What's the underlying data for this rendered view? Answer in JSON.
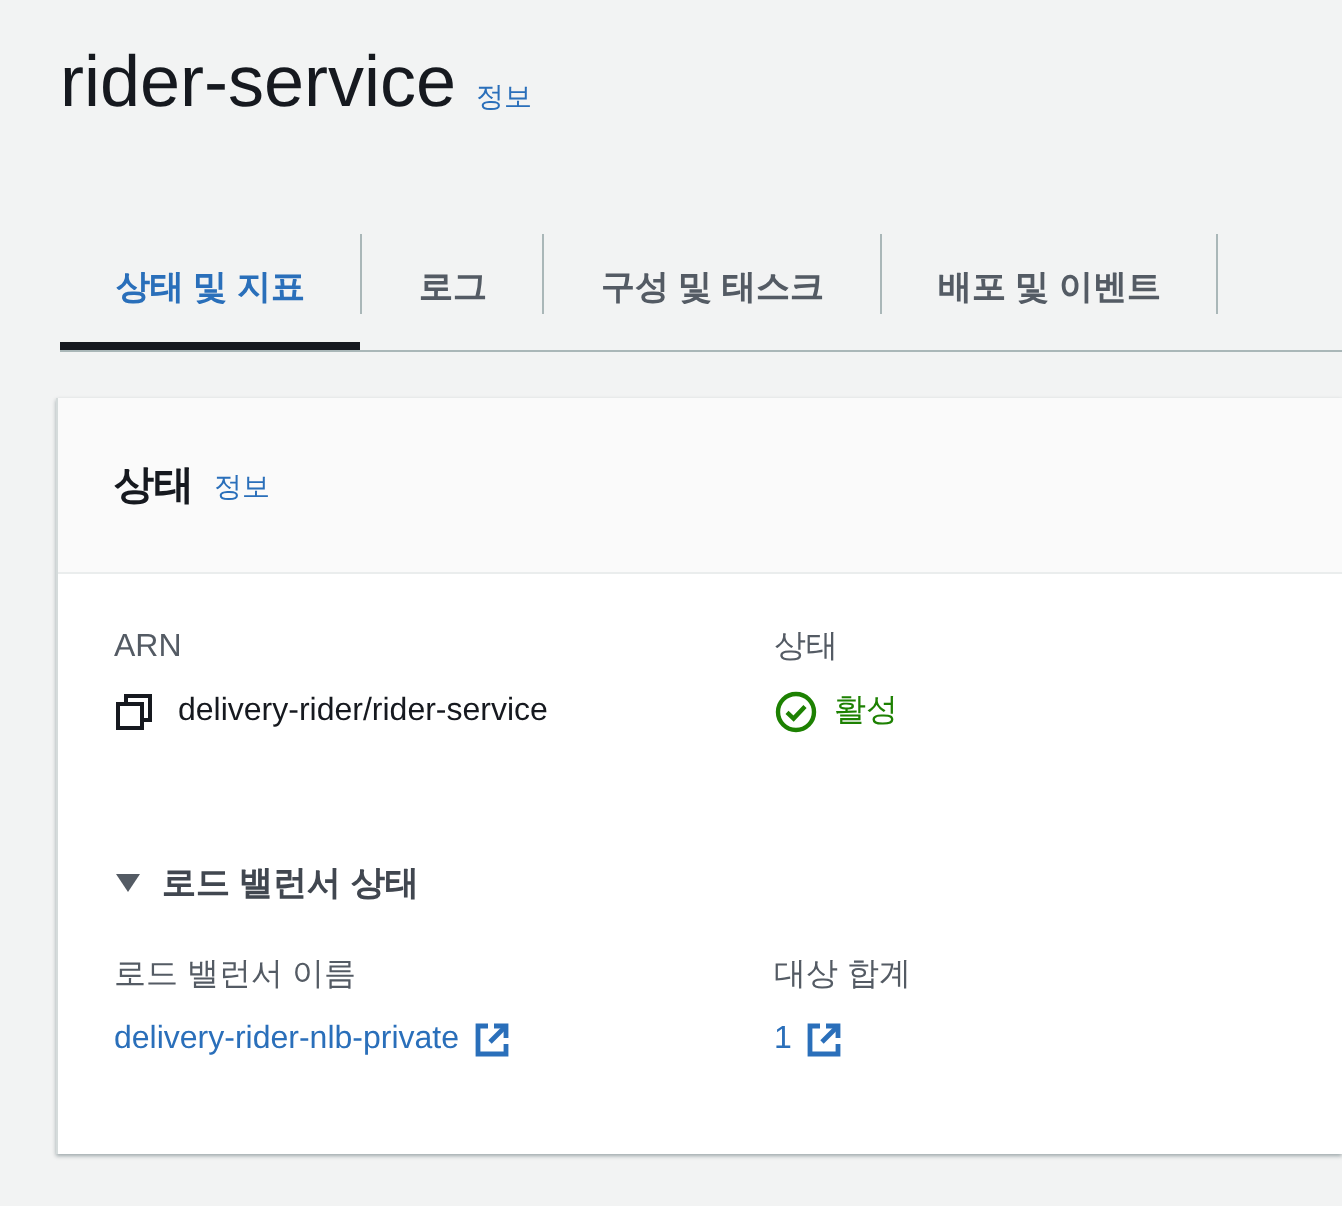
{
  "page": {
    "title": "rider-service",
    "info_link": "정보"
  },
  "tabs": [
    {
      "label": "상태 및 지표",
      "selected": true
    },
    {
      "label": "로그",
      "selected": false
    },
    {
      "label": "구성 및 태스크",
      "selected": false
    },
    {
      "label": "배포 및 이벤트",
      "selected": false
    }
  ],
  "status_panel": {
    "title": "상태",
    "info_link": "정보",
    "fields": [
      {
        "label": "ARN",
        "value": "delivery-rider/rider-service",
        "kind": "copy"
      },
      {
        "label": "상태",
        "value": "활성",
        "kind": "status"
      }
    ],
    "load_balancer_section": {
      "title": "로드 밸런서 상태",
      "expanded": true,
      "fields": [
        {
          "label": "로드 밸런서 이름",
          "value": "delivery-rider-nlb-private",
          "kind": "external_link"
        },
        {
          "label": "대상 합계",
          "value": "1",
          "kind": "external_link"
        }
      ]
    }
  }
}
